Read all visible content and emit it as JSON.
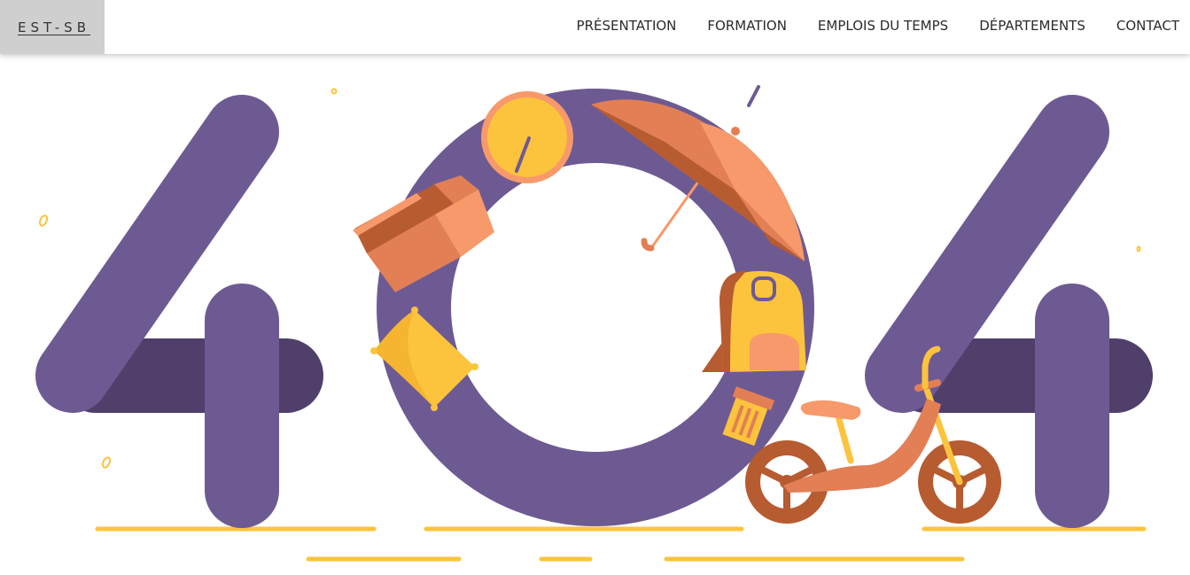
{
  "brand": {
    "label": "EST-SB"
  },
  "nav": {
    "items": [
      {
        "label": "PRÉSENTATION"
      },
      {
        "label": "FORMATION"
      },
      {
        "label": "EMPLOIS DU TEMPS"
      },
      {
        "label": "DÉPARTEMENTS"
      },
      {
        "label": "CONTACT"
      }
    ]
  },
  "illustration": {
    "icon_names": [
      "digit-four-left-icon",
      "digit-zero-ring-icon",
      "digit-four-right-icon",
      "clock-icon",
      "umbrella-icon",
      "box-icon",
      "pillow-icon",
      "backpack-icon",
      "trash-bin-icon",
      "balance-bike-icon"
    ]
  },
  "colors": {
    "purple": "#6E5A92",
    "dark_purple": "#4F3F6A",
    "yellow": "#FCC33D",
    "orange": "#E27F55",
    "light_orange": "#F7996A",
    "rust": "#B75B30",
    "nav_brand_bg": "#CFCFCF"
  }
}
